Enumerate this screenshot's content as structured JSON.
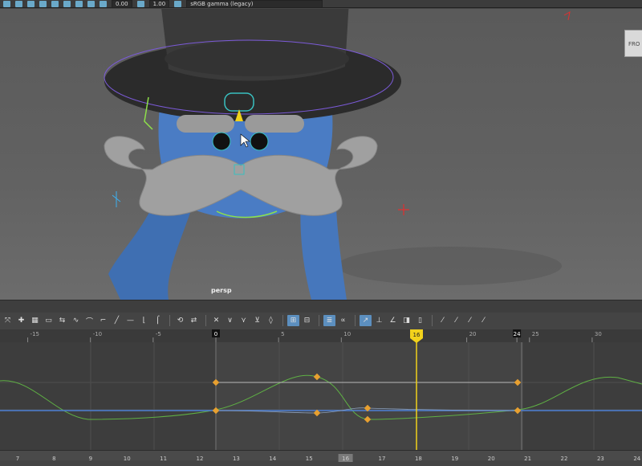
{
  "topbar": {
    "value_a": "0.00",
    "value_b": "1.00",
    "color_space": "sRGB gamma (legacy)"
  },
  "viewport": {
    "camera_label": "persp",
    "viewcube_label": "FRO"
  },
  "graph_editor": {
    "ruler_ticks": [
      "-15",
      "-10",
      "-5",
      "0",
      "5",
      "10",
      "16",
      "20",
      "24",
      "25",
      "30"
    ],
    "current_frame": "16",
    "range_start": "0",
    "range_end": "24",
    "time_slider_ticks": [
      "7",
      "8",
      "9",
      "10",
      "11",
      "12",
      "13",
      "14",
      "15",
      "16",
      "17",
      "18",
      "19",
      "20",
      "21",
      "22",
      "23",
      "24"
    ]
  },
  "colors": {
    "curve_green": "#5fb044",
    "curve_blue": "#4c7fd4",
    "curve_gray": "#b8b8b8",
    "key_orange": "#e8a030",
    "current_time": "#f2d21b"
  }
}
